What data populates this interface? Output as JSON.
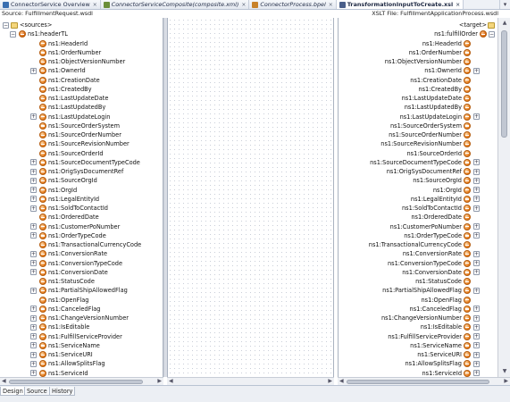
{
  "tabs": [
    {
      "label": "ConnectorService Overview",
      "icon": "service-icon",
      "color": "#3a6fb0"
    },
    {
      "label": "ConnectorServiceComposite(composite.xml)",
      "icon": "composite-icon",
      "color": "#6b8e3a"
    },
    {
      "label": "ConnectorProcess.bpel",
      "icon": "bpel-icon",
      "color": "#c8822a"
    },
    {
      "label": "TransformationInputToCreate.xsl",
      "icon": "xsl-icon",
      "color": "#4a5f8a"
    }
  ],
  "active_tab_index": 3,
  "source_header": "Source: FulfillmentRequest.wsdl",
  "target_header": "XSLT File: FulfillmentApplicationProcess.wsdl",
  "source_tree": {
    "sources_label": "<sources>",
    "root_label": "ns1:headerTL",
    "items": [
      {
        "label": "ns1:HeaderId",
        "exp": false
      },
      {
        "label": "ns1:OrderNumber",
        "exp": false
      },
      {
        "label": "ns1:ObjectVersionNumber",
        "exp": false
      },
      {
        "label": "ns1:OwnerId",
        "exp": true
      },
      {
        "label": "ns1:CreationDate",
        "exp": false
      },
      {
        "label": "ns1:CreatedBy",
        "exp": false
      },
      {
        "label": "ns1:LastUpdateDate",
        "exp": false
      },
      {
        "label": "ns1:LastUpdatedBy",
        "exp": false
      },
      {
        "label": "ns1:LastUpdateLogin",
        "exp": true
      },
      {
        "label": "ns1:SourceOrderSystem",
        "exp": false
      },
      {
        "label": "ns1:SourceOrderNumber",
        "exp": false
      },
      {
        "label": "ns1:SourceRevisionNumber",
        "exp": false
      },
      {
        "label": "ns1:SourceOrderId",
        "exp": false
      },
      {
        "label": "ns1:SourceDocumentTypeCode",
        "exp": true
      },
      {
        "label": "ns1:OrigSysDocumentRef",
        "exp": true
      },
      {
        "label": "ns1:SourceOrgId",
        "exp": true
      },
      {
        "label": "ns1:OrgId",
        "exp": true
      },
      {
        "label": "ns1:LegalEntityId",
        "exp": true
      },
      {
        "label": "ns1:SoldToContactId",
        "exp": true
      },
      {
        "label": "ns1:OrderedDate",
        "exp": false
      },
      {
        "label": "ns1:CustomerPoNumber",
        "exp": true
      },
      {
        "label": "ns1:OrderTypeCode",
        "exp": true
      },
      {
        "label": "ns1:TransactionalCurrencyCode",
        "exp": false
      },
      {
        "label": "ns1:ConversionRate",
        "exp": true
      },
      {
        "label": "ns1:ConversionTypeCode",
        "exp": true
      },
      {
        "label": "ns1:ConversionDate",
        "exp": true
      },
      {
        "label": "ns1:StatusCode",
        "exp": false
      },
      {
        "label": "ns1:PartialShipAllowedFlag",
        "exp": true
      },
      {
        "label": "ns1:OpenFlag",
        "exp": false
      },
      {
        "label": "ns1:CanceledFlag",
        "exp": true
      },
      {
        "label": "ns1:ChangeVersionNumber",
        "exp": true
      },
      {
        "label": "ns1:IsEditable",
        "exp": true
      },
      {
        "label": "ns1:FulfillServiceProvider",
        "exp": true
      },
      {
        "label": "ns1:ServiceName",
        "exp": true
      },
      {
        "label": "ns1:ServiceURI",
        "exp": true
      },
      {
        "label": "ns1:AllowSplitsFlag",
        "exp": true
      },
      {
        "label": "ns1:ServiceId",
        "exp": true
      }
    ]
  },
  "target_tree": {
    "sources_label": "<target>",
    "root_label": "ns1:fulfillOrder",
    "items": [
      {
        "label": "ns1:HeaderId",
        "exp": false
      },
      {
        "label": "ns1:OrderNumber",
        "exp": false
      },
      {
        "label": "ns1:ObjectVersionNumber",
        "exp": false
      },
      {
        "label": "ns1:OwnerId",
        "exp": true
      },
      {
        "label": "ns1:CreationDate",
        "exp": false
      },
      {
        "label": "ns1:CreatedBy",
        "exp": false
      },
      {
        "label": "ns1:LastUpdateDate",
        "exp": false
      },
      {
        "label": "ns1:LastUpdatedBy",
        "exp": false
      },
      {
        "label": "ns1:LastUpdateLogin",
        "exp": true
      },
      {
        "label": "ns1:SourceOrderSystem",
        "exp": false
      },
      {
        "label": "ns1:SourceOrderNumber",
        "exp": false
      },
      {
        "label": "ns1:SourceRevisionNumber",
        "exp": false
      },
      {
        "label": "ns1:SourceOrderId",
        "exp": false
      },
      {
        "label": "ns1:SourceDocumentTypeCode",
        "exp": true
      },
      {
        "label": "ns1:OrigSysDocumentRef",
        "exp": true
      },
      {
        "label": "ns1:SourceOrgId",
        "exp": true
      },
      {
        "label": "ns1:OrgId",
        "exp": true
      },
      {
        "label": "ns1:LegalEntityId",
        "exp": true
      },
      {
        "label": "ns1:SoldToContactId",
        "exp": true
      },
      {
        "label": "ns1:OrderedDate",
        "exp": false
      },
      {
        "label": "ns1:CustomerPoNumber",
        "exp": true
      },
      {
        "label": "ns1:OrderTypeCode",
        "exp": true
      },
      {
        "label": "ns1:TransactionalCurrencyCode",
        "exp": false
      },
      {
        "label": "ns1:ConversionRate",
        "exp": true
      },
      {
        "label": "ns1:ConversionTypeCode",
        "exp": true
      },
      {
        "label": "ns1:ConversionDate",
        "exp": true
      },
      {
        "label": "ns1:StatusCode",
        "exp": false
      },
      {
        "label": "ns1:PartialShipAllowedFlag",
        "exp": true
      },
      {
        "label": "ns1:OpenFlag",
        "exp": false
      },
      {
        "label": "ns1:CanceledFlag",
        "exp": true
      },
      {
        "label": "ns1:ChangeVersionNumber",
        "exp": true
      },
      {
        "label": "ns1:IsEditable",
        "exp": true
      },
      {
        "label": "ns1:FulfillServiceProvider",
        "exp": true
      },
      {
        "label": "ns1:ServiceName",
        "exp": true
      },
      {
        "label": "ns1:ServiceURI",
        "exp": true
      },
      {
        "label": "ns1:AllowSplitsFlag",
        "exp": true
      },
      {
        "label": "ns1:ServiceId",
        "exp": true
      }
    ]
  },
  "bottom_tabs": [
    "Design",
    "Source",
    "History"
  ],
  "active_bottom_tab": 0
}
